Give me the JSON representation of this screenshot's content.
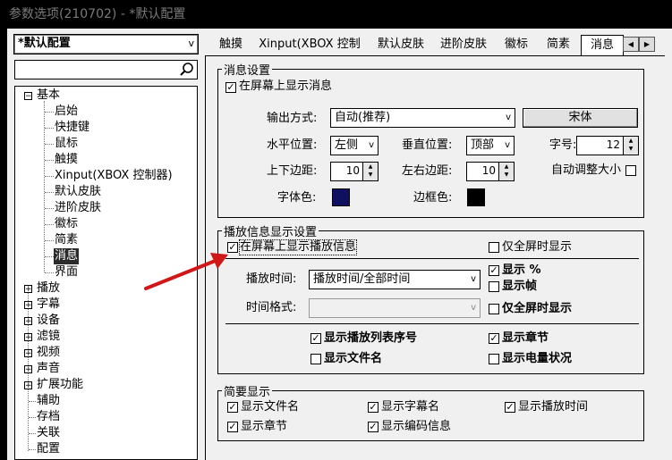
{
  "window": {
    "title": "参数选项(210702) - *默认配置"
  },
  "profile_select": {
    "value": "*默认配置"
  },
  "search": {
    "placeholder": ""
  },
  "tree": {
    "basic": "基本",
    "basic_children": [
      "启始",
      "快捷键",
      "鼠标",
      "触摸",
      "Xinput(XBOX 控制器)",
      "默认皮肤",
      "进阶皮肤",
      "徽标",
      "简素",
      "消息",
      "界面"
    ],
    "selected": "消息",
    "roots": [
      "播放",
      "字幕",
      "设备",
      "滤镜",
      "视频",
      "声音",
      "扩展功能"
    ],
    "leaves": [
      "辅助",
      "存档",
      "关联",
      "配置"
    ]
  },
  "tabs": [
    "触摸",
    "Xinput(XBOX 控制器)",
    "默认皮肤",
    "进阶皮肤",
    "徽标",
    "简素",
    "消息"
  ],
  "active_tab": "消息",
  "msg_settings": {
    "legend": "消息设置",
    "show_on_screen": "在屏幕上显示消息",
    "output_label": "输出方式:",
    "output_value": "自动(推荐)",
    "font_button": "宋体",
    "hpos_label": "水平位置:",
    "hpos_value": "左侧",
    "vpos_label": "垂直位置:",
    "vpos_value": "顶部",
    "size_label": "字号:",
    "size_value": "12",
    "tb_margin_label": "上下边距:",
    "tb_margin_value": "10",
    "lr_margin_label": "左右边距:",
    "lr_margin_value": "10",
    "autosize_label": "自动调整大小",
    "font_color_label": "字体色:",
    "font_color": "#101060",
    "border_color_label": "边框色:",
    "border_color": "#000000"
  },
  "playinfo": {
    "legend": "播放信息显示设置",
    "show_playinfo": "在屏幕上显示播放信息",
    "fullscreen_only": "仅全屏时显示",
    "play_time_label": "播放时间:",
    "play_time_value": "播放时间/全部时间",
    "show_percent": "显示 %",
    "show_frame": "显示帧",
    "time_format_label": "时间格式:",
    "time_format_value": "",
    "fullscreen_only2": "仅全屏时显示",
    "show_playlist_no": "显示播放列表序号",
    "show_chapter": "显示章节",
    "show_filename": "显示文件名",
    "show_battery": "显示电量状况"
  },
  "brief": {
    "legend": "简要显示",
    "items": [
      "显示文件名",
      "显示字幕名",
      "显示播放时间",
      "显示章节",
      "显示编码信息"
    ]
  },
  "colors": {
    "selection": "#2b2b2b",
    "arrow": "#d01818"
  }
}
